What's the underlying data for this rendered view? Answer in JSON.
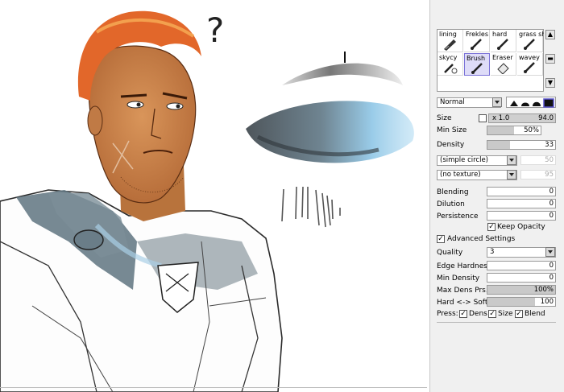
{
  "canvas": {
    "question_mark": "?"
  },
  "brush_grid": {
    "tools": [
      {
        "label": "lining"
      },
      {
        "label": "Frekles"
      },
      {
        "label": "hard"
      },
      {
        "label": "grass sha"
      },
      {
        "label": "skycy"
      },
      {
        "label": "Brush"
      },
      {
        "label": "Eraser"
      },
      {
        "label": "wavey"
      }
    ],
    "selected": "Brush"
  },
  "blend_mode": {
    "value": "Normal"
  },
  "size": {
    "label": "Size",
    "multiplier": "x 1.0",
    "value": "94.0"
  },
  "min_size": {
    "label": "Min Size",
    "value": "50%",
    "level": 0.5
  },
  "density": {
    "label": "Density",
    "value": "33",
    "level": 0.33
  },
  "shape": {
    "value": "(simple circle)",
    "amount": "50"
  },
  "texture": {
    "value": "(no texture)",
    "amount": "95"
  },
  "blending": {
    "label": "Blending",
    "value": "0"
  },
  "dilution": {
    "label": "Dilution",
    "value": "0"
  },
  "persistence": {
    "label": "Persistence",
    "value": "0"
  },
  "keep_opacity": {
    "label": "Keep Opacity",
    "checked": true
  },
  "advanced": {
    "label": "Advanced Settings",
    "checked": true
  },
  "quality": {
    "label": "Quality",
    "value": "3"
  },
  "edge_hardness": {
    "label": "Edge Hardness",
    "value": "0"
  },
  "min_density": {
    "label": "Min Density",
    "value": "0"
  },
  "max_dens_prs": {
    "label": "Max Dens Prs.",
    "value": "100%",
    "level": 1.0
  },
  "hard_soft": {
    "label": "Hard <-> Soft",
    "value": "100",
    "level": 0.7
  },
  "press": {
    "label": "Press:",
    "dens": "Dens",
    "size": "Size",
    "blend": "Blend"
  },
  "colors": {
    "selection": "#dedcf8",
    "panel_bg": "#f0f0f0"
  }
}
